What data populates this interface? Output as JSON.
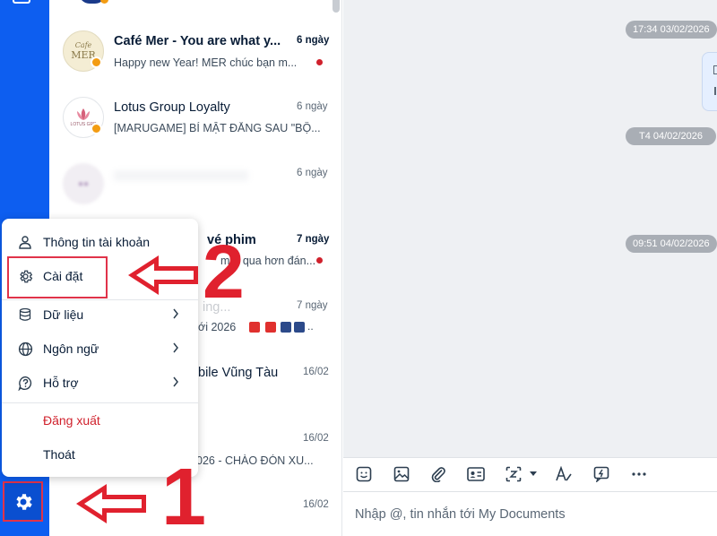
{
  "conversations": [
    {
      "name": "Café Mer - You are what y...",
      "preview": "Happy new Year! MER chúc bạn m...",
      "time": "6 ngày",
      "avatar_text": "MER",
      "avatar_sub": "Cafe"
    },
    {
      "name": "Lotus Group Loyalty",
      "preview": "[MARUGAME] BÍ MẬT ĐẰNG SAU \"BỘ...",
      "time": "6 ngày",
      "avatar_text": "LOTUS GRP"
    },
    {
      "name": "",
      "preview": "",
      "time": "6 ngày"
    },
    {
      "name": "vé phim",
      "preview": "mới qua hơn đán...",
      "time": "7 ngày"
    },
    {
      "name": "ing...",
      "preview": "ới 2026",
      "time": "7 ngày"
    },
    {
      "name": "bile Vũng Tàu",
      "preview": "",
      "time": "16/02"
    },
    {
      "name": "",
      "preview": "026 - CHÀO ĐÓN XU...",
      "time": "16/02"
    },
    {
      "name": "",
      "preview": "",
      "time": "16/02"
    }
  ],
  "menu": {
    "account": "Thông tin tài khoản",
    "settings": "Cài đặt",
    "data": "Dữ liệu",
    "language": "Ngôn ngữ",
    "support": "Hỗ trợ",
    "logout": "Đăng xuất",
    "quit": "Thoát"
  },
  "chat": {
    "timestamps": [
      "17:34 03/02/2026",
      "T4 04/02/2026",
      "09:51 04/02/2026"
    ],
    "input_placeholder": "Nhập @, tin nhắn tới My Documents"
  },
  "annotations": {
    "step1": "1",
    "step2": "2"
  },
  "colors": {
    "nav_blue": "#0d5ef0",
    "annotation_red": "#e0212e",
    "logout_red": "#d0212c"
  }
}
